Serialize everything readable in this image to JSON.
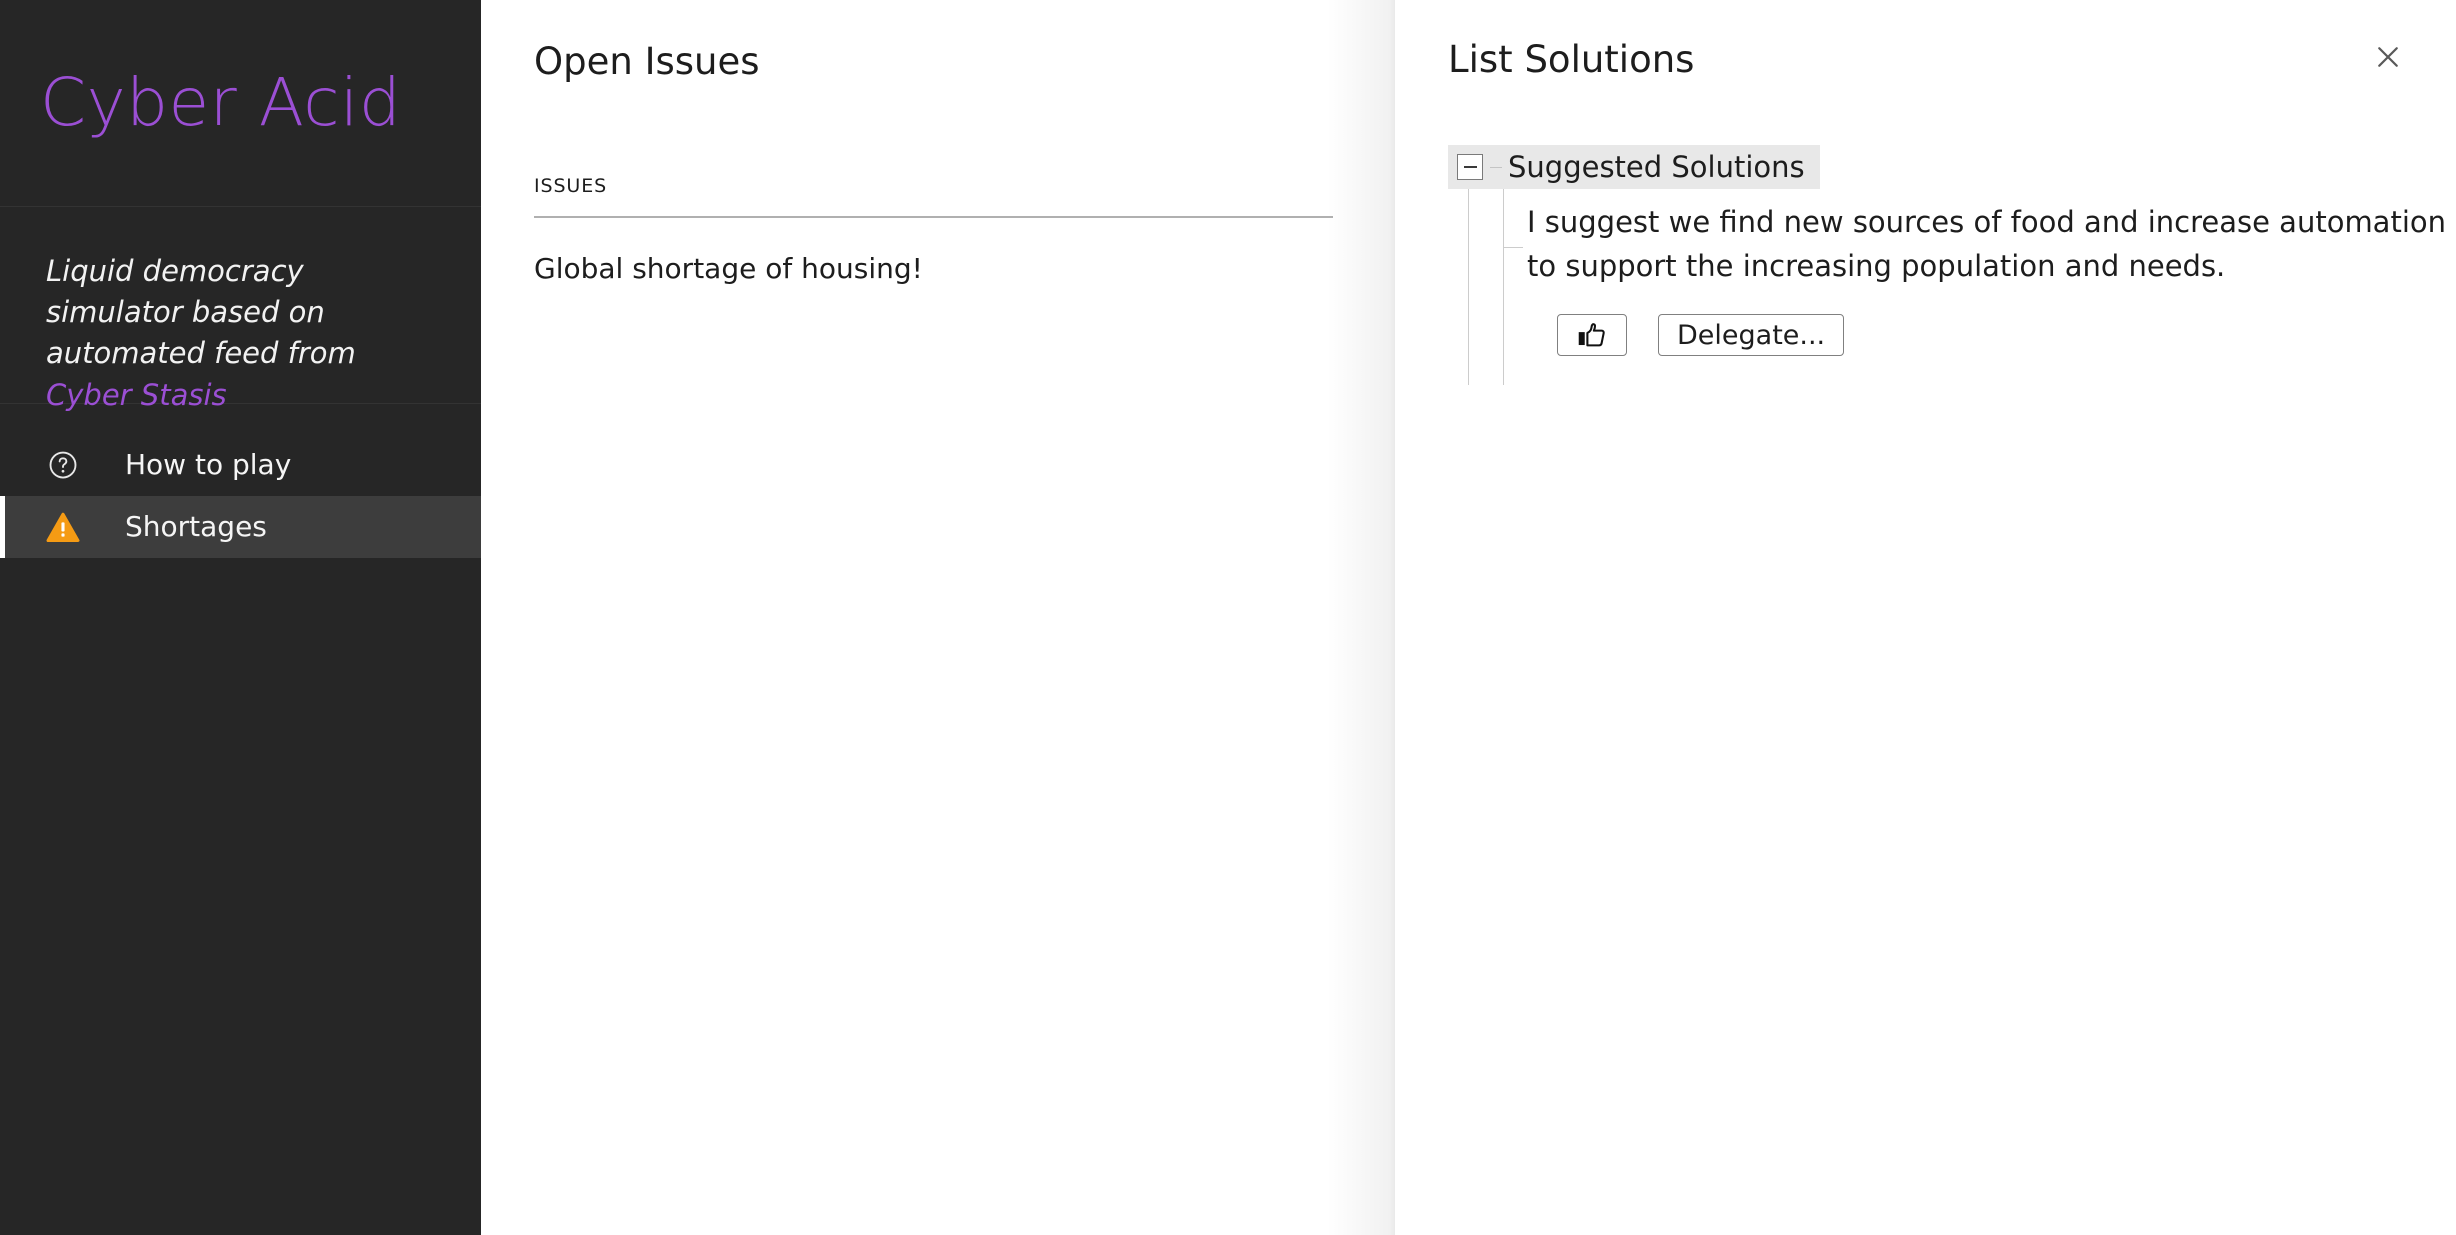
{
  "sidebar": {
    "brand": "Cyber Acid",
    "tagline_prefix": "Liquid democracy simulator based on automated feed from ",
    "tagline_link": "Cyber Stasis",
    "brand_color": "#9b4fd4",
    "nav_items": [
      {
        "label": "How to play",
        "icon": "question-circle-icon",
        "active": false
      },
      {
        "label": "Shortages",
        "icon": "warning-triangle-icon",
        "active": true,
        "icon_color": "#f59b14"
      }
    ]
  },
  "issues_panel": {
    "heading": "Open Issues",
    "table": {
      "columns": [
        "ISSUES"
      ],
      "rows": [
        [
          "Global shortage of housing!"
        ]
      ]
    }
  },
  "solutions_panel": {
    "title": "List Solutions",
    "close_icon": "close-icon",
    "tree": {
      "root_label": "Suggested Solutions",
      "toggle_state": "expanded",
      "toggle_icon": "minus-box-icon",
      "items": [
        {
          "text": "I suggest we find new sources of food and increase automation to support the increasing population and needs.",
          "actions": {
            "upvote_icon": "thumbs-up-icon",
            "upvote_label": "",
            "delegate_label": "Delegate..."
          }
        }
      ]
    }
  }
}
